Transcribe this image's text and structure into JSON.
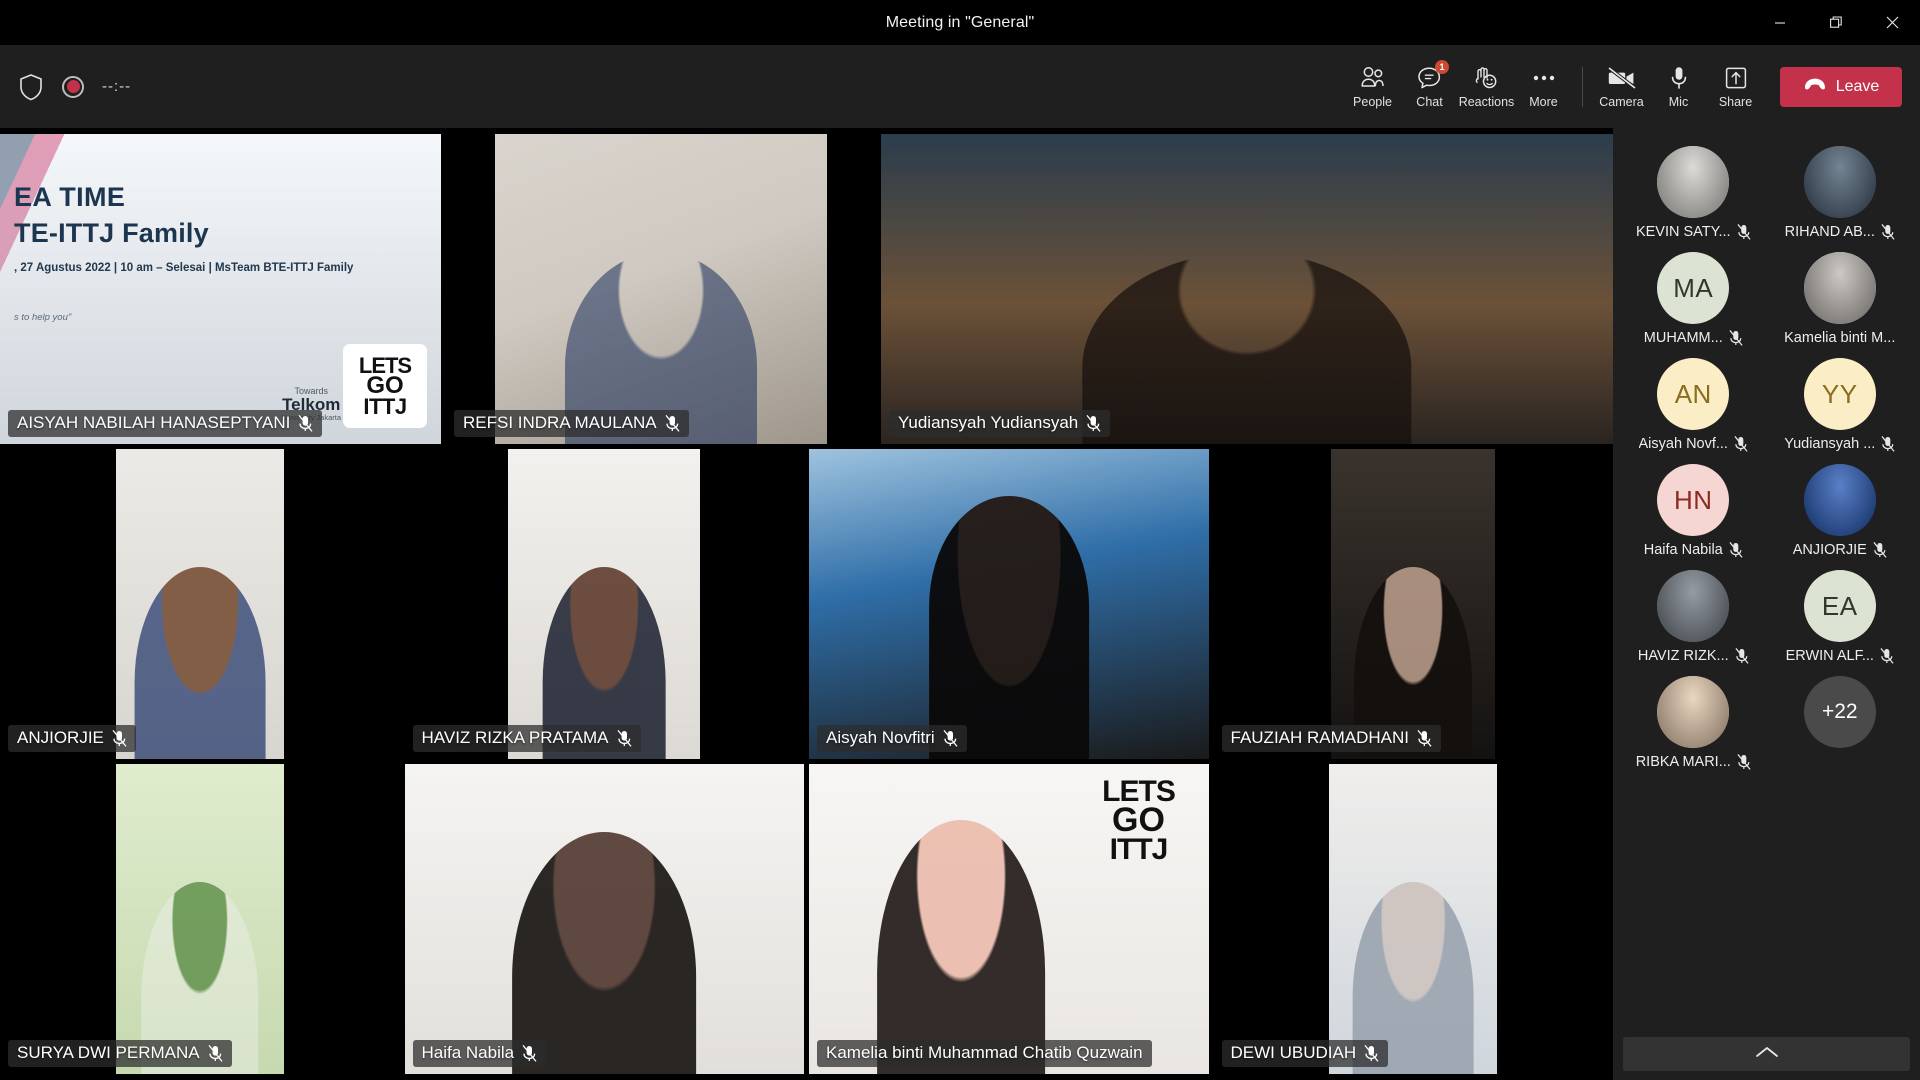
{
  "window": {
    "title": "Meeting in \"General\"",
    "minimize_label": "Minimize",
    "restore_label": "Restore",
    "close_label": "Close"
  },
  "toolbar": {
    "shield_icon": "shield-icon",
    "recording_icon": "recording-indicator-icon",
    "timer": "--:--",
    "items": [
      {
        "label": "People",
        "icon": "people-icon",
        "badge": ""
      },
      {
        "label": "Chat",
        "icon": "chat-icon",
        "badge": "1"
      },
      {
        "label": "Reactions",
        "icon": "reactions-icon",
        "badge": ""
      },
      {
        "label": "More",
        "icon": "more-icon",
        "badge": ""
      },
      {
        "label": "Camera",
        "icon": "camera-off-icon",
        "badge": ""
      },
      {
        "label": "Mic",
        "icon": "mic-icon",
        "badge": ""
      },
      {
        "label": "Share",
        "icon": "share-icon",
        "badge": ""
      }
    ],
    "leave_label": "Leave",
    "leave_color": "#c4314b"
  },
  "slide": {
    "line1": "EA TIME",
    "line2": "TE-ITTJ Family",
    "line3": ", 27 Agustus 2022 | 10 am – Selesai | MsTeam BTE-ITTJ Family",
    "line4": "s to help you\"",
    "brand_towards": "Towards",
    "brand_telkom": "Telkom",
    "brand_univ": "University Jakarta",
    "logo_l1": "LETS",
    "logo_l2": "GO",
    "logo_l3": "ITTJ"
  },
  "stage": {
    "rows": [
      {
        "tiles": [
          {
            "name": "AISYAH NABILAH  HANASEPTYANI",
            "muted": true,
            "bg": "bg-slide",
            "fit": "full",
            "kind": "slide"
          },
          {
            "name": "REFSI INDRA MAULANA",
            "muted": true,
            "bg": "bg-room1",
            "fit": "portrait",
            "kind": "person"
          },
          {
            "name": "Yudiansyah Yudiansyah",
            "muted": true,
            "bg": "bg-space",
            "fit": "full",
            "kind": "person"
          }
        ]
      },
      {
        "tiles": [
          {
            "name": "ANJIORJIE",
            "muted": true,
            "bg": "bg-wall",
            "fit": "portrait",
            "kind": "person"
          },
          {
            "name": "HAVIZ RIZKA  PRATAMA",
            "muted": true,
            "bg": "bg-wall2",
            "fit": "portrait",
            "kind": "person"
          },
          {
            "name": "Aisyah  Novfitri",
            "muted": true,
            "bg": "bg-office",
            "fit": "portrait-wide",
            "kind": "person"
          },
          {
            "name": "FAUZIAH  RAMADHANI",
            "muted": true,
            "bg": "bg-dark",
            "fit": "portrait",
            "kind": "person"
          }
        ]
      },
      {
        "tiles": [
          {
            "name": "SURYA DWI  PERMANA",
            "muted": true,
            "bg": "bg-green",
            "fit": "portrait",
            "kind": "person"
          },
          {
            "name": "Haifa  Nabila",
            "muted": true,
            "bg": "bg-white",
            "fit": "portrait-wide",
            "kind": "person"
          },
          {
            "name": "Kamelia binti Muhammad Chatib  Quzwain",
            "muted": false,
            "bg": "bg-logo",
            "fit": "portrait-wide",
            "kind": "person"
          },
          {
            "name": "DEWI  UBUDIAH",
            "muted": true,
            "bg": "bg-clinic",
            "fit": "portrait",
            "kind": "person"
          }
        ]
      }
    ]
  },
  "roster": {
    "participants": [
      {
        "name": "KEVIN SATY...",
        "muted": true,
        "avatar_type": "photo",
        "avatar_bg": "#cfcdc8",
        "initials": ""
      },
      {
        "name": "RIHAND AB...",
        "muted": true,
        "avatar_type": "photo",
        "avatar_bg": "#3f5468",
        "initials": ""
      },
      {
        "name": "MUHAMM...",
        "muted": true,
        "avatar_type": "initials",
        "avatar_bg": "#dde3d3",
        "initials": "MA",
        "initials_color": "#2f3a2a"
      },
      {
        "name": "Kamelia binti M...",
        "muted": false,
        "avatar_type": "photo",
        "avatar_bg": "#b9b4ae",
        "initials": ""
      },
      {
        "name": "Aisyah Novf...",
        "muted": true,
        "avatar_type": "initials",
        "avatar_bg": "#fbeec6",
        "initials": "AN",
        "initials_color": "#8a6d1e"
      },
      {
        "name": "Yudiansyah ...",
        "muted": true,
        "avatar_type": "initials",
        "avatar_bg": "#fbeec6",
        "initials": "YY",
        "initials_color": "#8a6d1e"
      },
      {
        "name": "Haifa Nabila",
        "muted": true,
        "avatar_type": "initials",
        "avatar_bg": "#f6d6d2",
        "initials": "HN",
        "initials_color": "#8c2b22"
      },
      {
        "name": "ANJIORJIE",
        "muted": true,
        "avatar_type": "photo",
        "avatar_bg": "#1b4fb0",
        "initials": ""
      },
      {
        "name": "HAVIZ RIZK...",
        "muted": true,
        "avatar_type": "photo",
        "avatar_bg": "#6d7680",
        "initials": ""
      },
      {
        "name": "ERWIN ALF...",
        "muted": true,
        "avatar_type": "initials",
        "avatar_bg": "#dde3d3",
        "initials": "EA",
        "initials_color": "#2f3a2a"
      },
      {
        "name": "RIBKA MARI...",
        "muted": true,
        "avatar_type": "photo",
        "avatar_bg": "#e3c7a8",
        "initials": ""
      }
    ],
    "overflow_label": "+22",
    "expand_icon": "chevron-up-icon"
  }
}
